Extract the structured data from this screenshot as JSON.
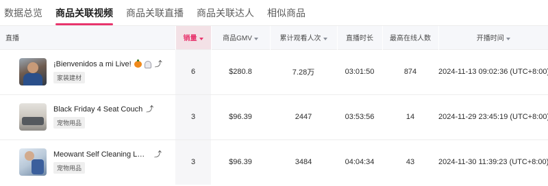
{
  "tabs": [
    {
      "label": "数据总览",
      "active": false
    },
    {
      "label": "商品关联视频",
      "active": true
    },
    {
      "label": "商品关联直播",
      "active": false
    },
    {
      "label": "商品关联达人",
      "active": false
    },
    {
      "label": "相似商品",
      "active": false
    }
  ],
  "accent_color": "#e8356d",
  "table": {
    "columns": [
      {
        "label": "直播",
        "sortable": false
      },
      {
        "label": "销量",
        "sortable": true,
        "sorted": true
      },
      {
        "label": "商品GMV",
        "sortable": true
      },
      {
        "label": "累计观看人次",
        "sortable": true
      },
      {
        "label": "直播时长",
        "sortable": false
      },
      {
        "label": "最高在线人数",
        "sortable": false
      },
      {
        "label": "开播时间",
        "sortable": true
      }
    ],
    "rows": [
      {
        "title": "¡Bienvenidos a mi Live!",
        "title_icons": [
          "pumpkin-icon",
          "ghost-icon"
        ],
        "category": "家装建材",
        "sales": "6",
        "gmv": "$280.8",
        "views": "7.28万",
        "duration": "03:01:50",
        "peak_online": "874",
        "start_time": "2024-11-13 09:02:36 (UTC+8:00)"
      },
      {
        "title": "Black Friday 4 Seat Couch",
        "title_icons": [],
        "category": "宠物用品",
        "sales": "3",
        "gmv": "$96.39",
        "views": "2447",
        "duration": "03:53:56",
        "peak_online": "14",
        "start_time": "2024-11-29 23:45:19 (UTC+8:00)"
      },
      {
        "title": "Meowant Self Cleaning Litter Box",
        "title_icons": [],
        "category": "宠物用品",
        "sales": "3",
        "gmv": "$96.39",
        "views": "3484",
        "duration": "04:04:34",
        "peak_online": "43",
        "start_time": "2024-11-30 11:39:23 (UTC+8:00)"
      }
    ]
  }
}
